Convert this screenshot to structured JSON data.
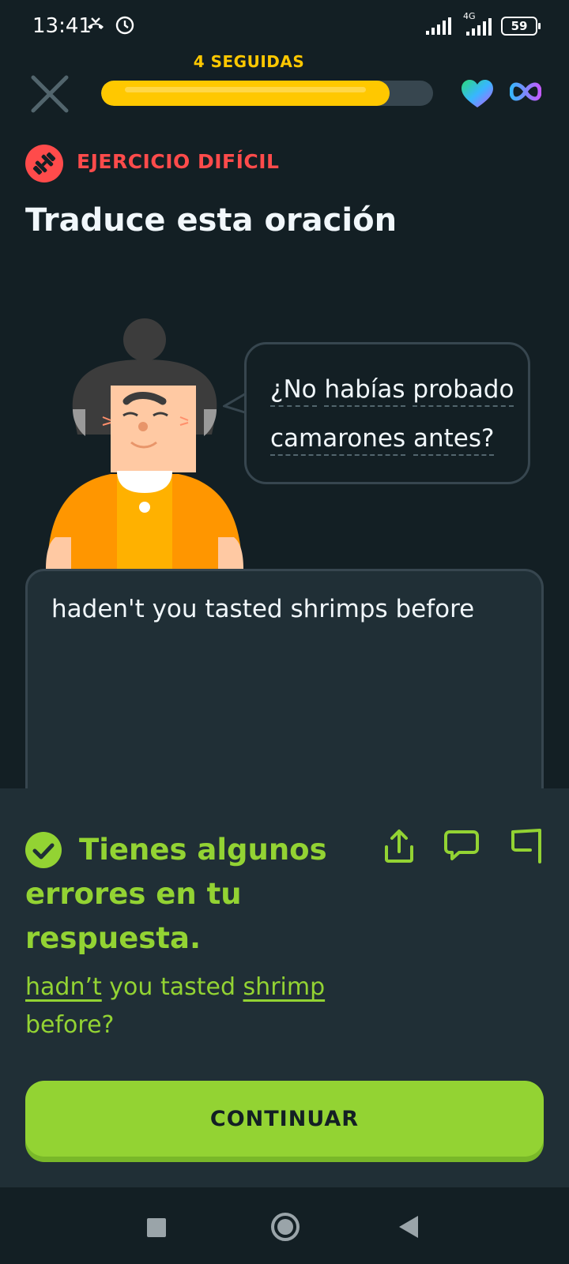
{
  "status_bar": {
    "time": "13:41",
    "network": "4G",
    "battery": "59"
  },
  "header": {
    "streak_label": "4 SEGUIDAS",
    "progress_fraction": 0.87,
    "accent_color": "#ffc800"
  },
  "exercise": {
    "badge_label": "EJERCICIO DIFÍCIL",
    "title": "Traduce esta oración",
    "prompt_words": [
      "¿No",
      "habías",
      "probado",
      "camarones",
      "antes?"
    ],
    "user_answer": "haden't you tasted shrimps before"
  },
  "feedback": {
    "title": "Tienes algunos errores en tu respuesta.",
    "correction": {
      "w1": "hadn’t",
      "w2": " you tasted ",
      "w3": "shrimp",
      "w4": " before?"
    },
    "continue_label": "CONTINUAR",
    "color": "#93d333"
  }
}
